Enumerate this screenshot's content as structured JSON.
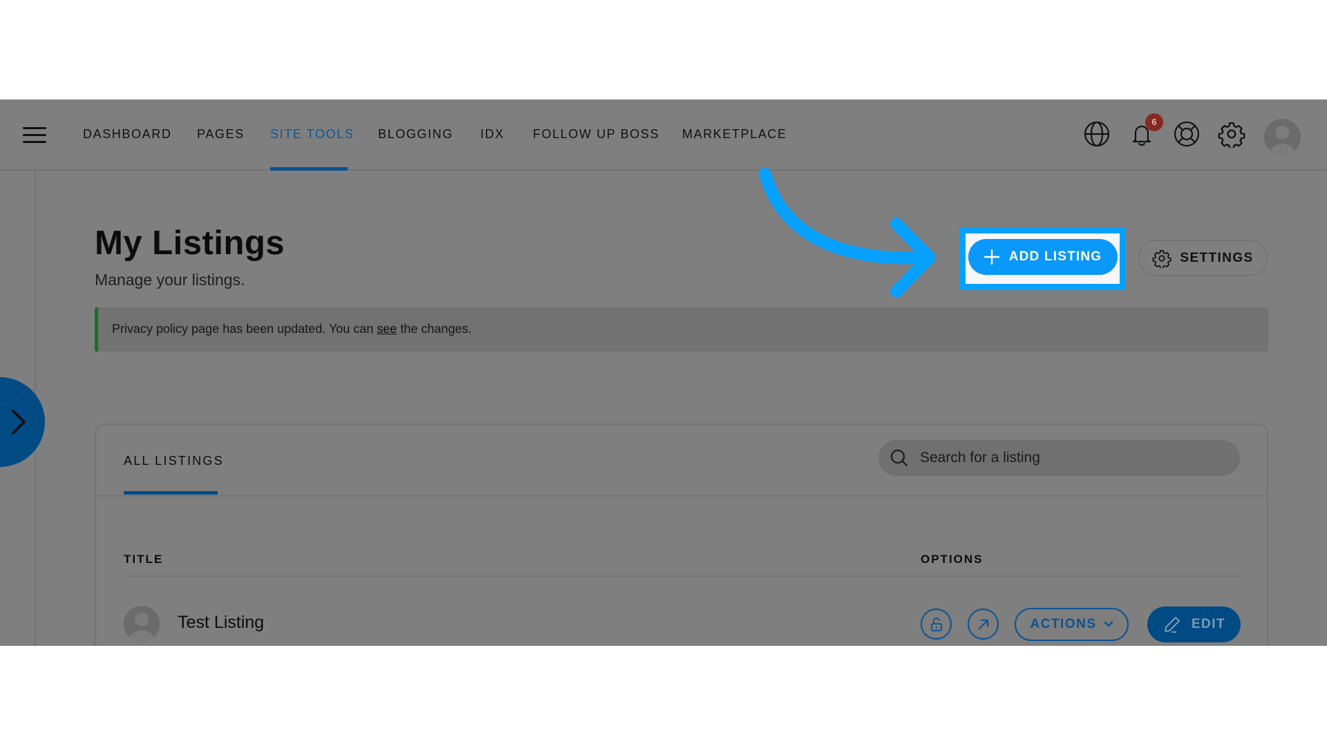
{
  "nav": {
    "items": [
      {
        "label": "DASHBOARD",
        "active": false
      },
      {
        "label": "PAGES",
        "active": false
      },
      {
        "label": "SITE TOOLS",
        "active": true
      },
      {
        "label": "BLOGGING",
        "active": false
      },
      {
        "label": "IDX",
        "active": false
      },
      {
        "label": "FOLLOW UP BOSS",
        "active": false
      },
      {
        "label": "MARKETPLACE",
        "active": false
      }
    ],
    "icons": [
      "hamburger-menu-icon",
      "globe-icon",
      "bell-icon",
      "lifebuoy-icon",
      "gear-icon",
      "avatar-icon"
    ],
    "notification_count": "6"
  },
  "header": {
    "title": "My Listings",
    "subtitle": "Manage your listings.",
    "add_button_label": "ADD LISTING",
    "settings_button_label": "SETTINGS"
  },
  "alert": {
    "text_before": "Privacy policy page has been updated. You can ",
    "link_text": "see",
    "text_after": " the changes."
  },
  "listings": {
    "tab_label": "ALL LISTINGS",
    "search_placeholder": "Search for a listing",
    "columns": [
      "TITLE",
      "OPTIONS"
    ],
    "rows": [
      {
        "title": "Test Listing",
        "actions_label": "ACTIONS",
        "edit_label": "EDIT"
      }
    ]
  },
  "colors": {
    "accent": "#06a0fe",
    "brand": "#004b84",
    "badge": "#842a22",
    "alert_border": "#1f6b2a"
  }
}
